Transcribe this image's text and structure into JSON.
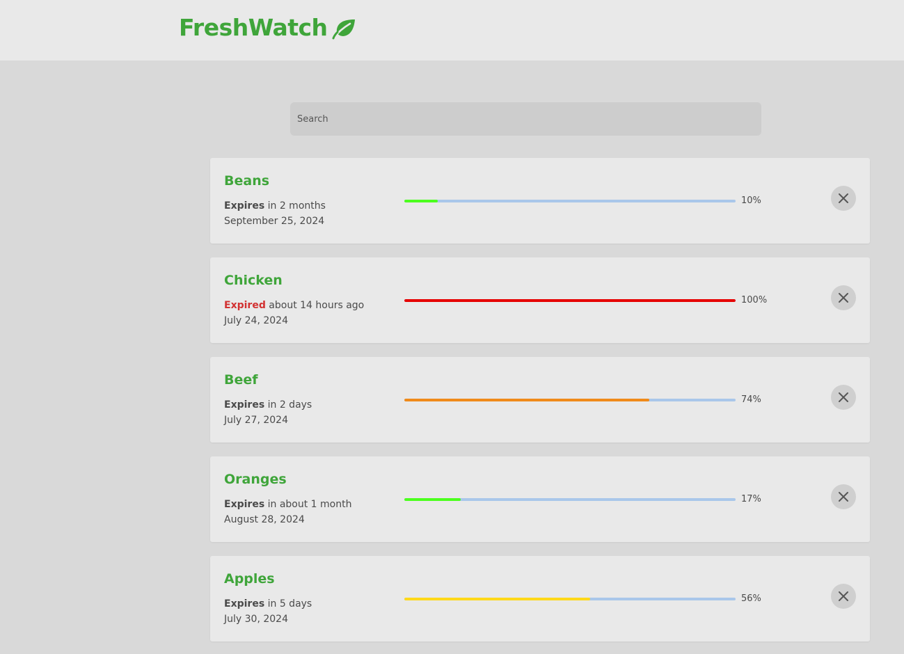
{
  "app": {
    "title": "FreshWatch",
    "brand_color": "#3fa53a",
    "logo_icon": "leaf-icon"
  },
  "search": {
    "placeholder": "Search",
    "value": ""
  },
  "items": [
    {
      "name": "Beans",
      "status_label": "Expires",
      "status_text": "in 2 months",
      "expired": false,
      "date": "September 25, 2024",
      "progress": 10,
      "progress_text": "10%",
      "bar_color": "#4cff1e"
    },
    {
      "name": "Chicken",
      "status_label": "Expired",
      "status_text": "about 14 hours ago",
      "expired": true,
      "date": "July 24, 2024",
      "progress": 100,
      "progress_text": "100%",
      "bar_color": "#e60000"
    },
    {
      "name": "Beef",
      "status_label": "Expires",
      "status_text": "in 2 days",
      "expired": false,
      "date": "July 27, 2024",
      "progress": 74,
      "progress_text": "74%",
      "bar_color": "#f08a1a"
    },
    {
      "name": "Oranges",
      "status_label": "Expires",
      "status_text": "in about 1 month",
      "expired": false,
      "date": "August 28, 2024",
      "progress": 17,
      "progress_text": "17%",
      "bar_color": "#4cff1e"
    },
    {
      "name": "Apples",
      "status_label": "Expires",
      "status_text": "in 5 days",
      "expired": false,
      "date": "July 30, 2024",
      "progress": 56,
      "progress_text": "56%",
      "bar_color": "#ffd91a"
    }
  ],
  "remove_icon": "close-icon",
  "track_color": "#a9c7ea",
  "expired_color": "#d23131"
}
